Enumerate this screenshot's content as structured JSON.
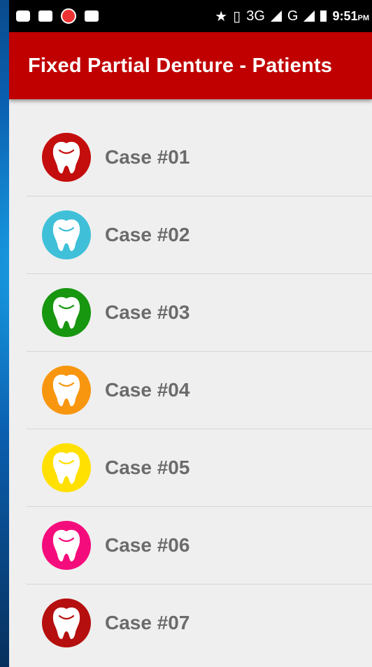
{
  "status_bar": {
    "network": "3G",
    "network_sup": "3G",
    "network2": "G",
    "time": "9:51",
    "ampm": "PM"
  },
  "app_bar": {
    "title": "Fixed Partial Denture - Patients"
  },
  "cases": [
    {
      "label": "Case #01",
      "color": "#c40d0d"
    },
    {
      "label": "Case #02",
      "color": "#3fc0d8"
    },
    {
      "label": "Case #03",
      "color": "#17960f"
    },
    {
      "label": "Case #04",
      "color": "#f8960f"
    },
    {
      "label": "Case #05",
      "color": "#ffe000"
    },
    {
      "label": "Case #06",
      "color": "#f50c7c"
    },
    {
      "label": "Case #07",
      "color": "#b50f0f"
    }
  ]
}
